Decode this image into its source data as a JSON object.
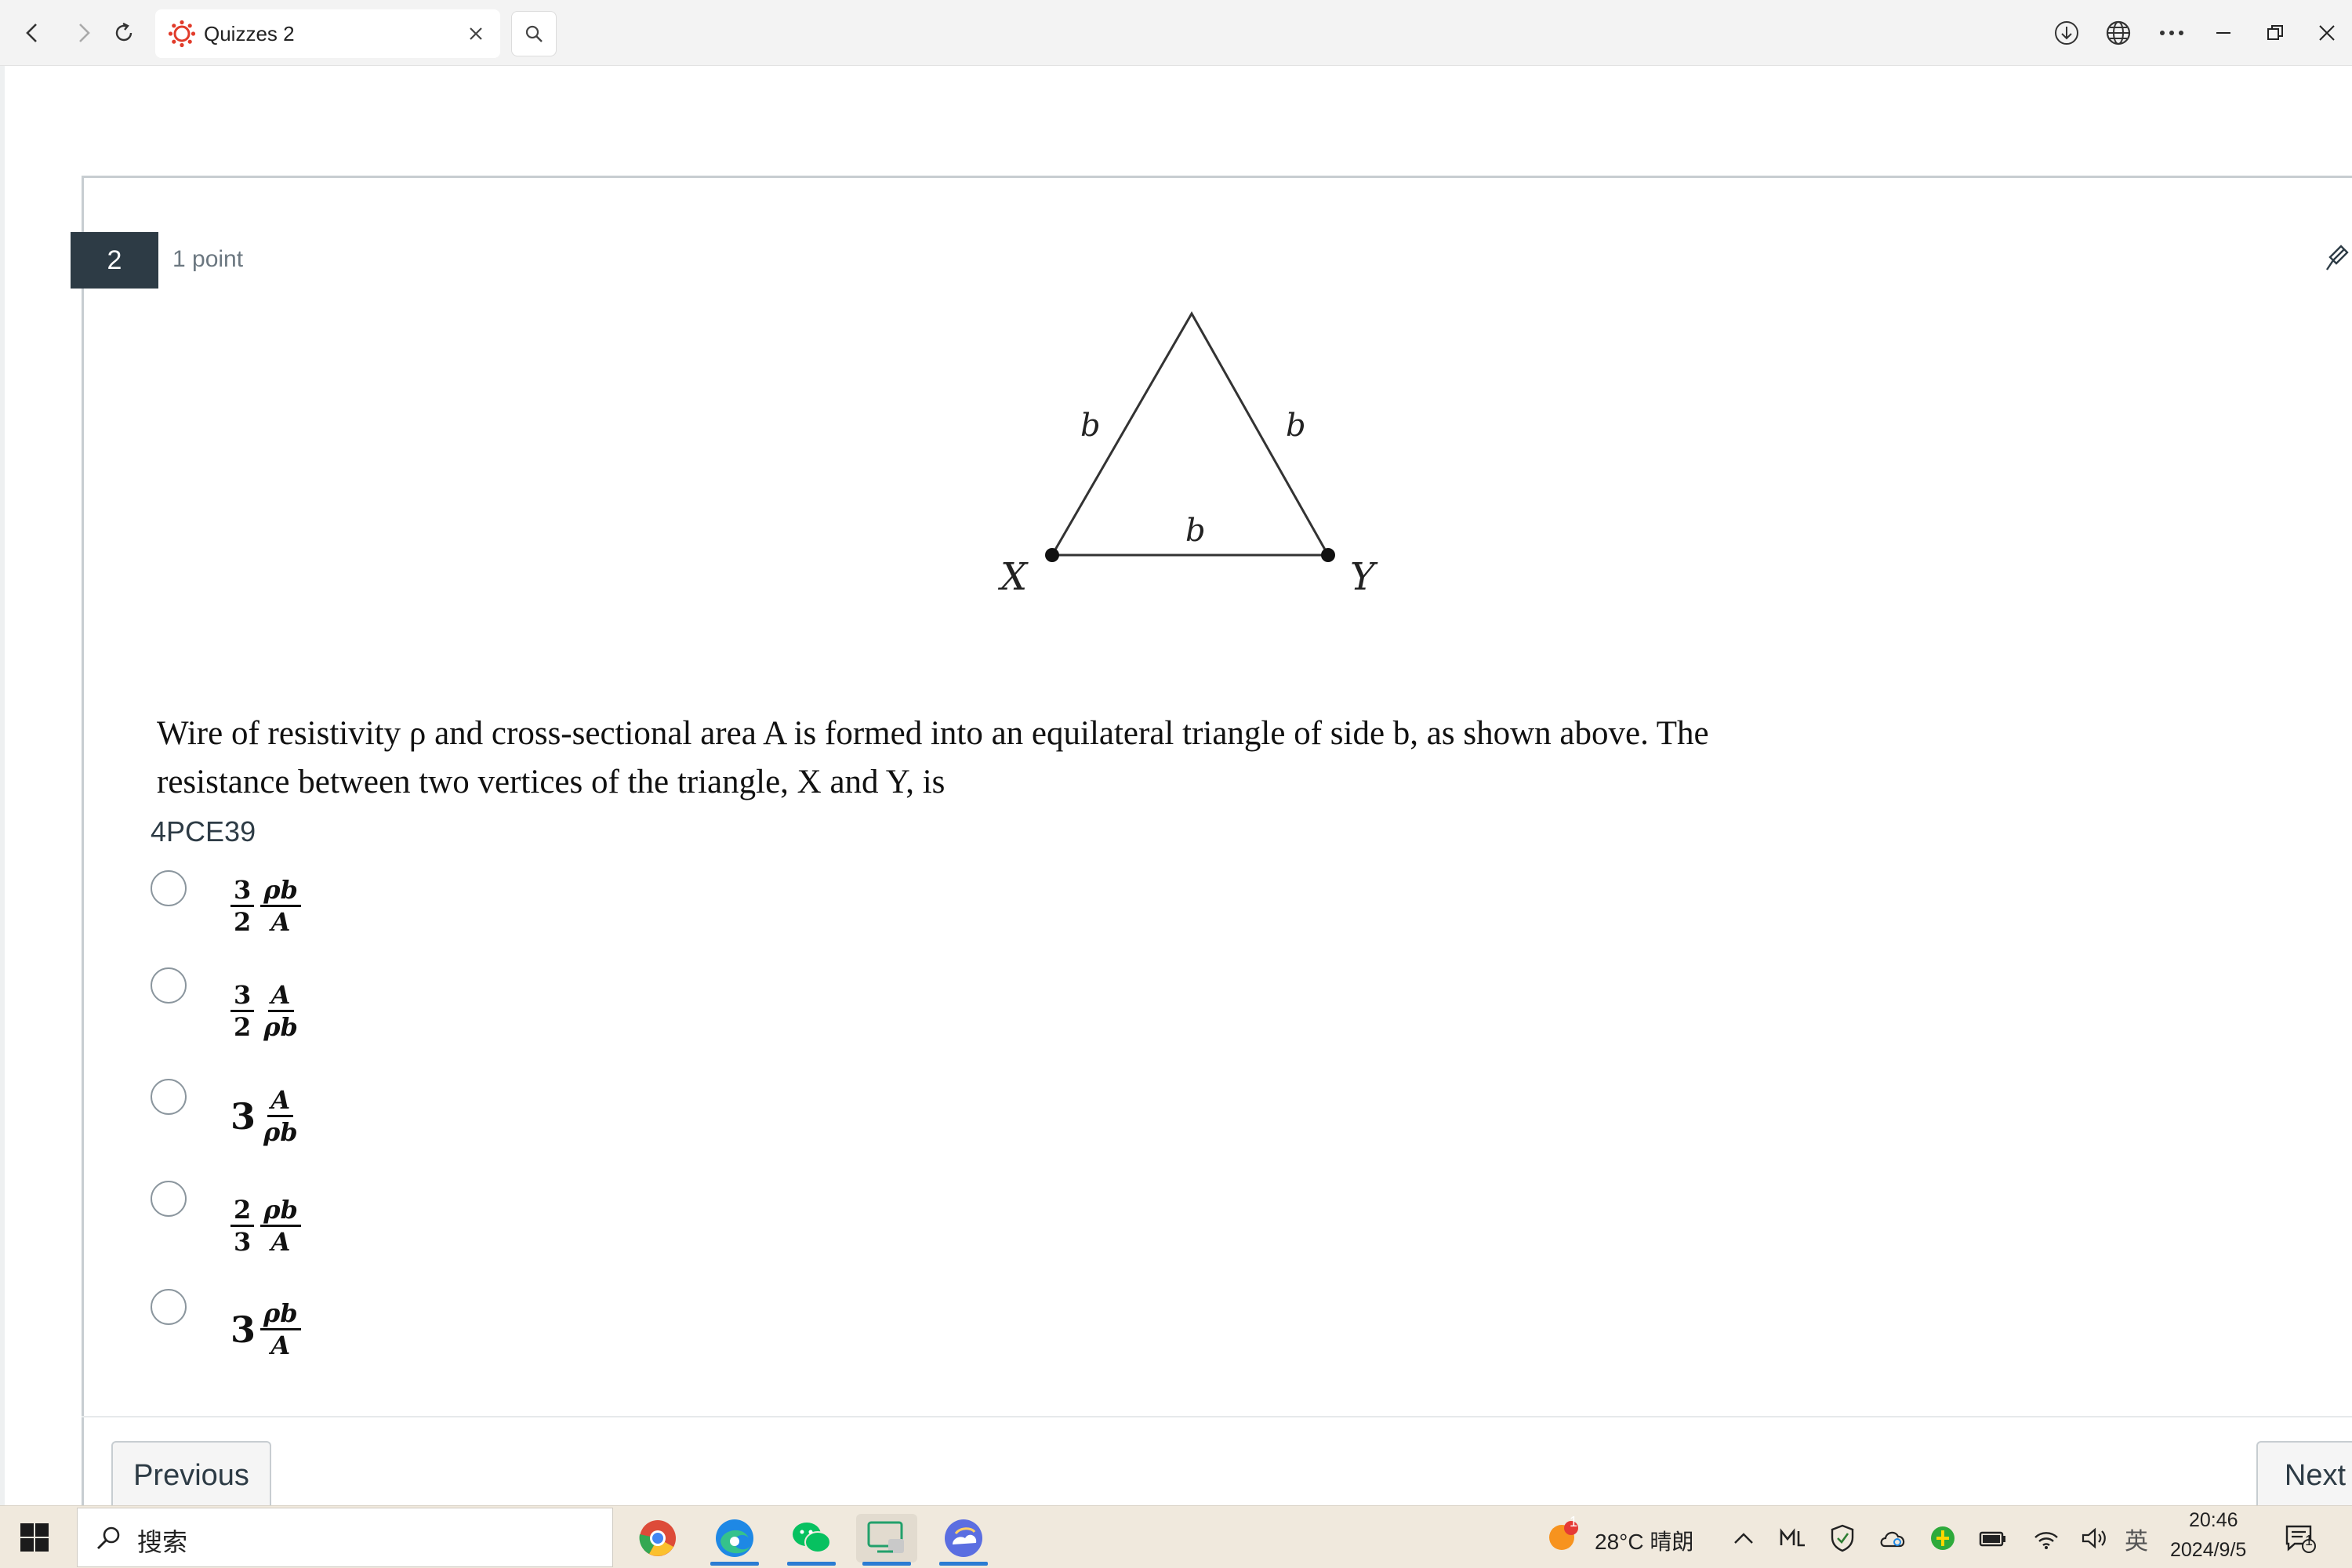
{
  "browser": {
    "tab_title": "Quizzes 2",
    "icons": [
      "back-icon",
      "forward-icon",
      "refresh-icon",
      "search-icon",
      "download-icon",
      "globe-icon",
      "more-icon",
      "minimize-icon",
      "restore-icon",
      "close-icon"
    ]
  },
  "question": {
    "number": "2",
    "points": "1 point",
    "text_line1": "Wire of resistivity ρ and cross-sectional area A is formed into an equilateral triangle of side b, as shown above. The",
    "text_line2": "resistance between two vertices of the triangle, X and Y, is",
    "code": "4PCE39",
    "figure": {
      "side_label": "b",
      "vertex_left": "X",
      "vertex_right": "Y"
    },
    "options": [
      {
        "coef_num": "3",
        "coef_den": "2",
        "num": "ρb",
        "den": "A"
      },
      {
        "coef_num": "3",
        "coef_den": "2",
        "num": "A",
        "den": "ρb"
      },
      {
        "coef": "3",
        "num": "A",
        "den": "ρb"
      },
      {
        "coef_num": "2",
        "coef_den": "3",
        "num": "ρb",
        "den": "A"
      },
      {
        "coef": "3",
        "num": "ρb",
        "den": "A"
      }
    ]
  },
  "navigation": {
    "previous": "Previous",
    "next": "Next"
  },
  "taskbar": {
    "search_placeholder": "搜索",
    "weather": "28°C  晴朗",
    "weather_badge": "1",
    "ime": "英",
    "time": "20:46",
    "date": "2024/9/5",
    "notification_count": "1"
  }
}
